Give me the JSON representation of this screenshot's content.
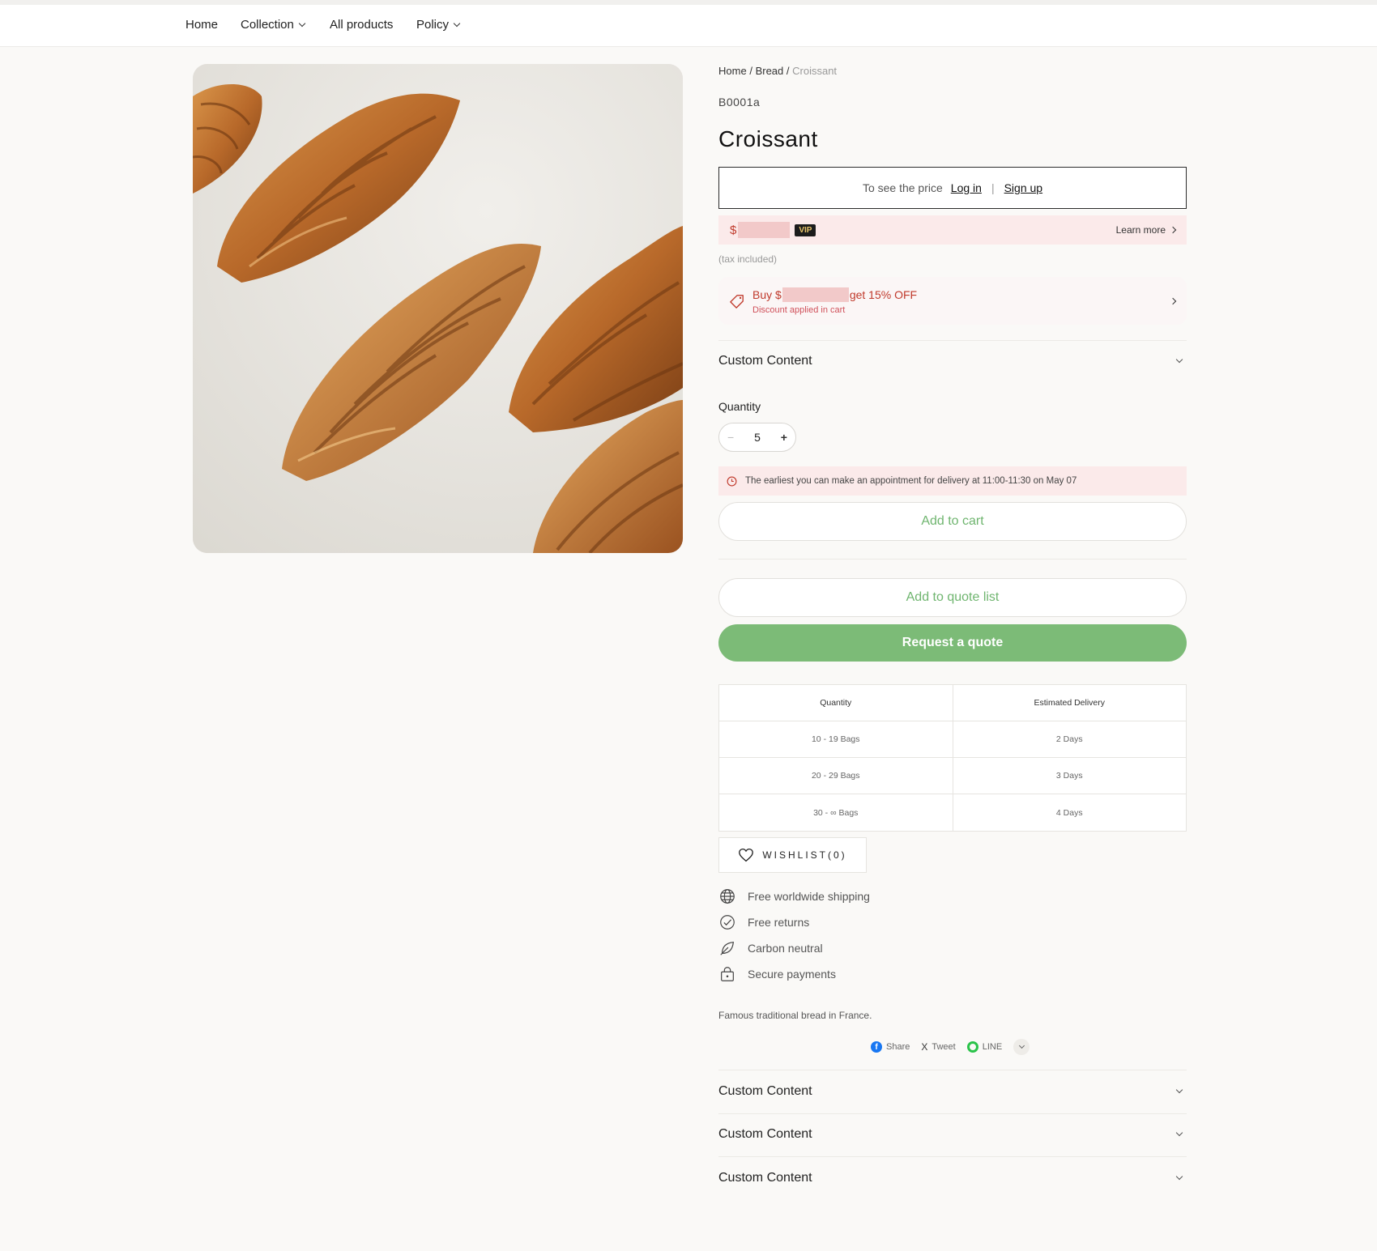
{
  "nav": {
    "home": "Home",
    "collection": "Collection",
    "all_products": "All products",
    "policy": "Policy"
  },
  "breadcrumb": {
    "home": "Home",
    "sep": "/",
    "bread": "Bread",
    "current": "Croissant"
  },
  "product": {
    "sku": "B0001a",
    "title": "Croissant",
    "tax_note": "(tax included)",
    "description": "Famous traditional bread in France."
  },
  "price_gate": {
    "prompt": "To see the price",
    "login": "Log in",
    "separator": "|",
    "signup": "Sign up"
  },
  "vip": {
    "currency": "$",
    "badge": "VIP",
    "learn_more": "Learn more"
  },
  "promo": {
    "buy": "Buy $",
    "offer": "get 15% OFF",
    "note": "Discount applied in cart"
  },
  "accordion_top": "Custom Content",
  "quantity": {
    "label": "Quantity",
    "minus": "−",
    "value": "5",
    "plus": "+"
  },
  "appointment": "The earliest you can make an appointment for delivery at 11:00-11:30 on May 07",
  "buttons": {
    "add_to_cart": "Add to cart",
    "add_to_quote": "Add to quote list",
    "request_quote": "Request a quote"
  },
  "delivery_table": {
    "headers": [
      "Quantity",
      "Estimated Delivery"
    ],
    "rows": [
      [
        "10 - 19 Bags",
        "2 Days"
      ],
      [
        "20 - 29 Bags",
        "3 Days"
      ],
      [
        "30 - ∞ Bags",
        "4 Days"
      ]
    ]
  },
  "wishlist": "WISHLIST(0)",
  "features": [
    "Free worldwide shipping",
    "Free returns",
    "Carbon neutral",
    "Secure payments"
  ],
  "share": {
    "facebook": "Share",
    "x": "Tweet",
    "line": "LINE"
  },
  "accordions_bottom": [
    "Custom Content",
    "Custom Content",
    "Custom Content"
  ],
  "colors": {
    "accent_green": "#7cbb77",
    "promo_red": "#c0392b",
    "pink_bg": "#fbeaea"
  }
}
